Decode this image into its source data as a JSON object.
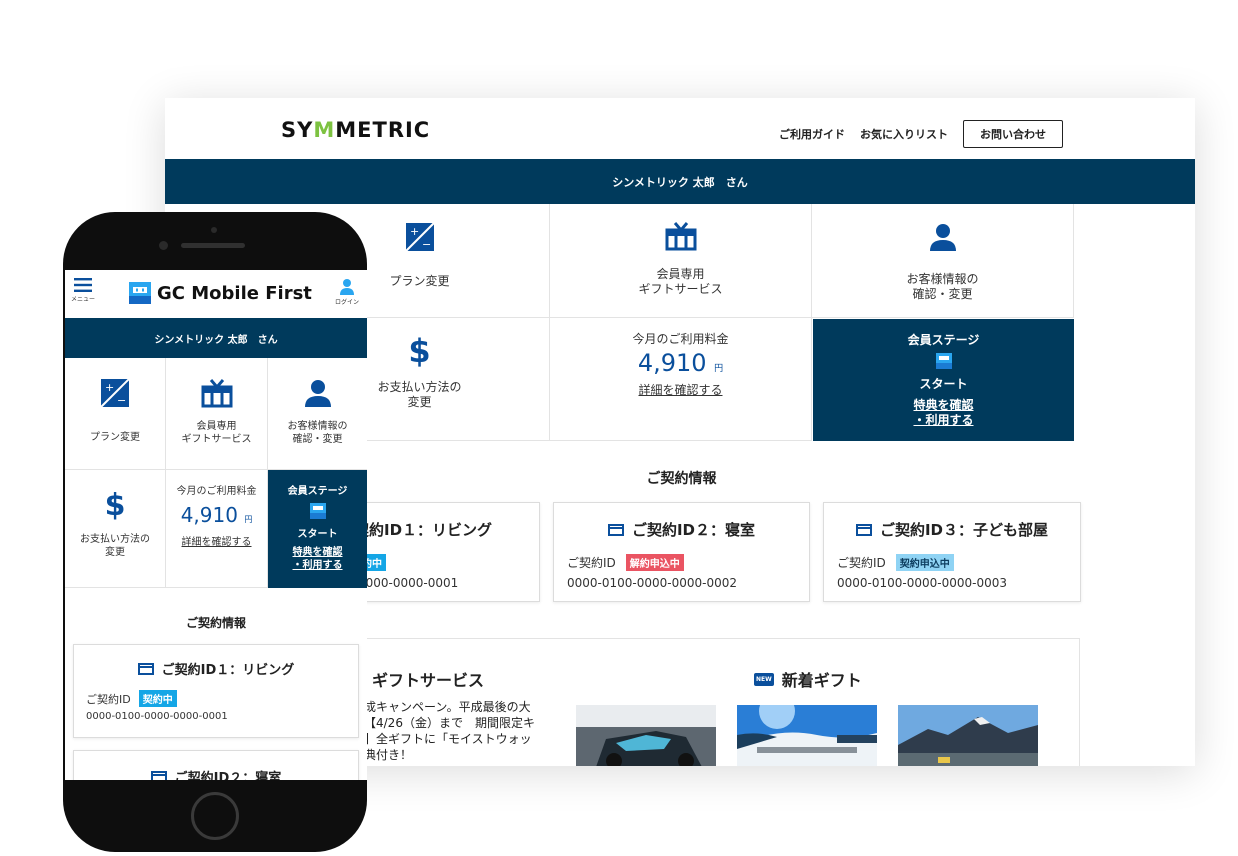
{
  "desktop": {
    "logo": {
      "pre": "SY",
      "mark": "M",
      "post": "METRIC",
      "full": "SYMETRIC"
    },
    "nav": {
      "guide": "ご利用ガイド",
      "favorites": "お気に入りリスト",
      "contact": "お問い合わせ"
    },
    "user_band": "シンメトリック 太郎　さん",
    "tiles": {
      "plan": "プラン変更",
      "gift_line1": "会員専用",
      "gift_line2": "ギフトサービス",
      "profile_line1": "お客様情報の",
      "profile_line2": "確認・変更",
      "payment_line1": "お支払い方法の",
      "payment_line2": "変更",
      "fee_label": "今月のご利用料金",
      "fee_amount": "4,910",
      "fee_unit": "円",
      "fee_link": "詳細を確認する",
      "stage_label": "会員ステージ",
      "stage_value": "スタート",
      "stage_link1": "特典を確認",
      "stage_link2": "・利用する"
    },
    "contracts_title": "ご契約情報",
    "contracts": [
      {
        "title": "契約ID１：リビング",
        "id_label": "",
        "status": "約中",
        "number": "0000-0000-0001"
      },
      {
        "title": "ご契約ID２：寝室",
        "id_label": "ご契約ID",
        "status": "解約申込中",
        "number": "0000-0100-0000-0000-0002"
      },
      {
        "title": "ご契約ID３：子ども部屋",
        "id_label": "ご契約ID",
        "status": "契約申込中",
        "number": "0000-0100-0000-0000-0003"
      }
    ],
    "gift": {
      "title": "ギフトサービス",
      "text_lines": [
        "成キャンペーン。平成最後の大",
        "【4/26（金）まで　期間限定キ",
        "】全ギフトに「モイストウォッ",
        "典付き！"
      ],
      "new_badge": "NEW",
      "new_title": "新着ギフト"
    }
  },
  "mobile": {
    "menu_label": "メニュー",
    "brand": "GC Mobile First",
    "login_label": "ログイン",
    "user_band": "シンメトリック 太郎　さん",
    "tiles": {
      "plan": "プラン変更",
      "gift_line1": "会員専用",
      "gift_line2": "ギフトサービス",
      "profile_line1": "お客様情報の",
      "profile_line2": "確認・変更",
      "payment_line1": "お支払い方法の",
      "payment_line2": "変更",
      "fee_label": "今月のご利用料金",
      "fee_amount": "4,910",
      "fee_unit": "円",
      "fee_link": "詳細を確認する",
      "stage_label": "会員ステージ",
      "stage_value": "スタート",
      "stage_link1": "特典を確認",
      "stage_link2": "・利用する"
    },
    "contracts_title": "ご契約情報",
    "contracts": [
      {
        "title": "ご契約ID１：リビング",
        "id_label": "ご契約ID",
        "status": "契約中",
        "number": "0000-0100-0000-0000-0001"
      },
      {
        "title": "ご契約ID２：寝室"
      }
    ]
  },
  "colors": {
    "navy": "#003a5c",
    "accent_blue": "#0a4f9c",
    "badge_blue": "#14a6e6",
    "badge_red": "#ea5462",
    "logo_green": "#7dc241"
  }
}
